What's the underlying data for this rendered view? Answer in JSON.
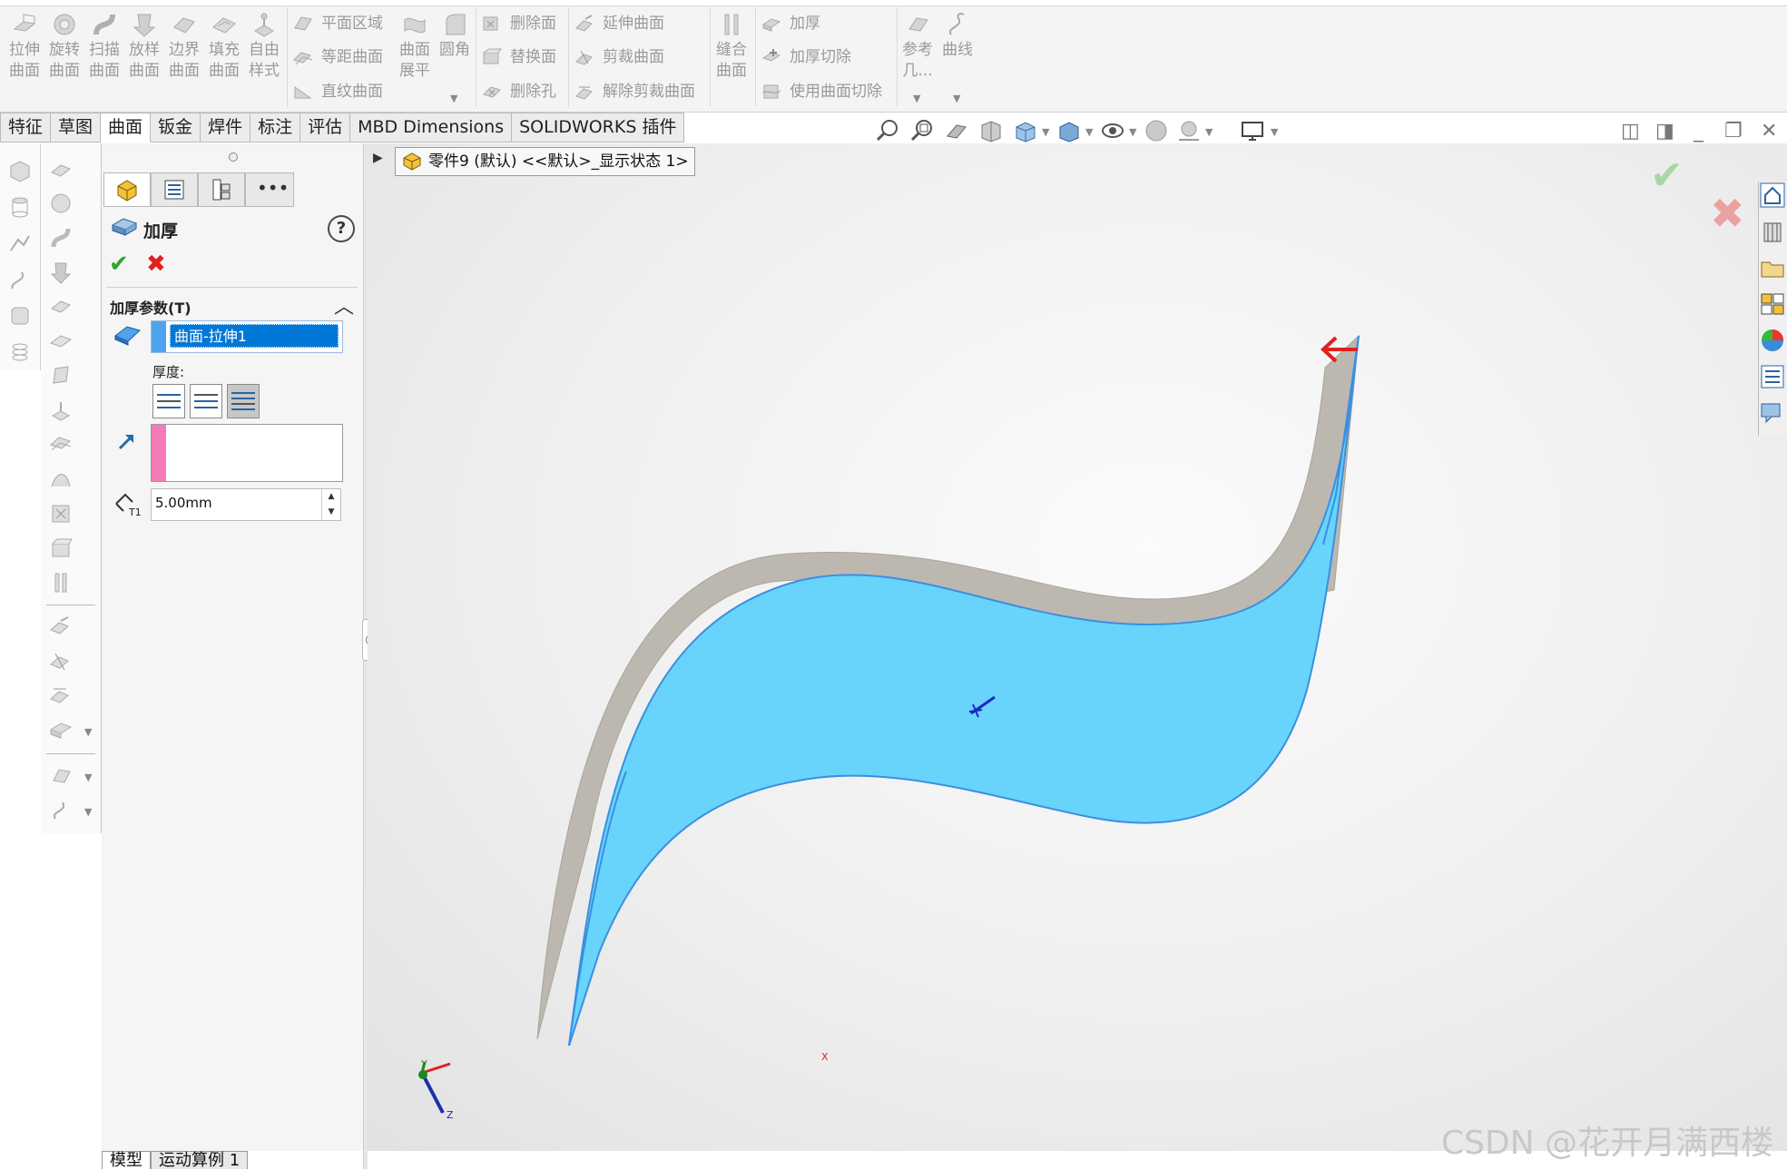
{
  "ribbon": {
    "large_buttons": [
      {
        "line1": "拉伸",
        "line2": "曲面",
        "icon": "extruded-surface-icon"
      },
      {
        "line1": "旋转",
        "line2": "曲面",
        "icon": "revolved-surface-icon"
      },
      {
        "line1": "扫描",
        "line2": "曲面",
        "icon": "swept-surface-icon"
      },
      {
        "line1": "放样",
        "line2": "曲面",
        "icon": "lofted-surface-icon"
      },
      {
        "line1": "边界",
        "line2": "曲面",
        "icon": "boundary-surface-icon"
      },
      {
        "line1": "填充",
        "line2": "曲面",
        "icon": "filled-surface-icon"
      },
      {
        "line1": "自由",
        "line2": "样式",
        "icon": "freeform-icon"
      }
    ],
    "group2": {
      "planar": "平面区域",
      "offset": "等距曲面",
      "ruled": "直纹曲面",
      "flatten_line1": "曲面",
      "flatten_line2": "展平",
      "fillet": "圆角"
    },
    "group3": {
      "delete_face": "删除面",
      "replace_face": "替换面",
      "delete_hole": "删除孔"
    },
    "group4": {
      "extend": "延伸曲面",
      "trim": "剪裁曲面",
      "untrim": "解除剪裁曲面"
    },
    "knit": {
      "line1": "缝合",
      "line2": "曲面"
    },
    "group5": {
      "thicken": "加厚",
      "thicken_cut": "加厚切除",
      "cut_with_surface": "使用曲面切除"
    },
    "ref_geometry": {
      "line1": "参考",
      "line2": "几..."
    },
    "curves": "曲线"
  },
  "tabs": [
    "特征",
    "草图",
    "曲面",
    "钣金",
    "焊件",
    "标注",
    "评估",
    "MBD Dimensions",
    "SOLIDWORKS 插件"
  ],
  "breadcrumb": "零件9 (默认) <<默认>_显示状态 1>",
  "property_manager": {
    "title": "加厚",
    "help": "?",
    "ok": "✔",
    "cancel": "✖",
    "group_title": "加厚参数(T)",
    "selected_surface": "曲面-拉伸1",
    "thickness_label": "厚度:",
    "thickness_value": "5.00mm",
    "t1_label": "T1"
  },
  "bottom_tabs": [
    "模型",
    "运动算例 1"
  ],
  "triad": {
    "x": "X",
    "y": "Y",
    "z": "Z"
  },
  "watermark": "CSDN @花开月满西楼",
  "colors": {
    "surface_blue": "#68d4fb",
    "surface_edge": "#3b8fe0",
    "surface_grey": "#b9b5ae",
    "ok_green": "#2da52d",
    "cancel_red": "#e02020",
    "selection_blue": "#0078d7"
  }
}
